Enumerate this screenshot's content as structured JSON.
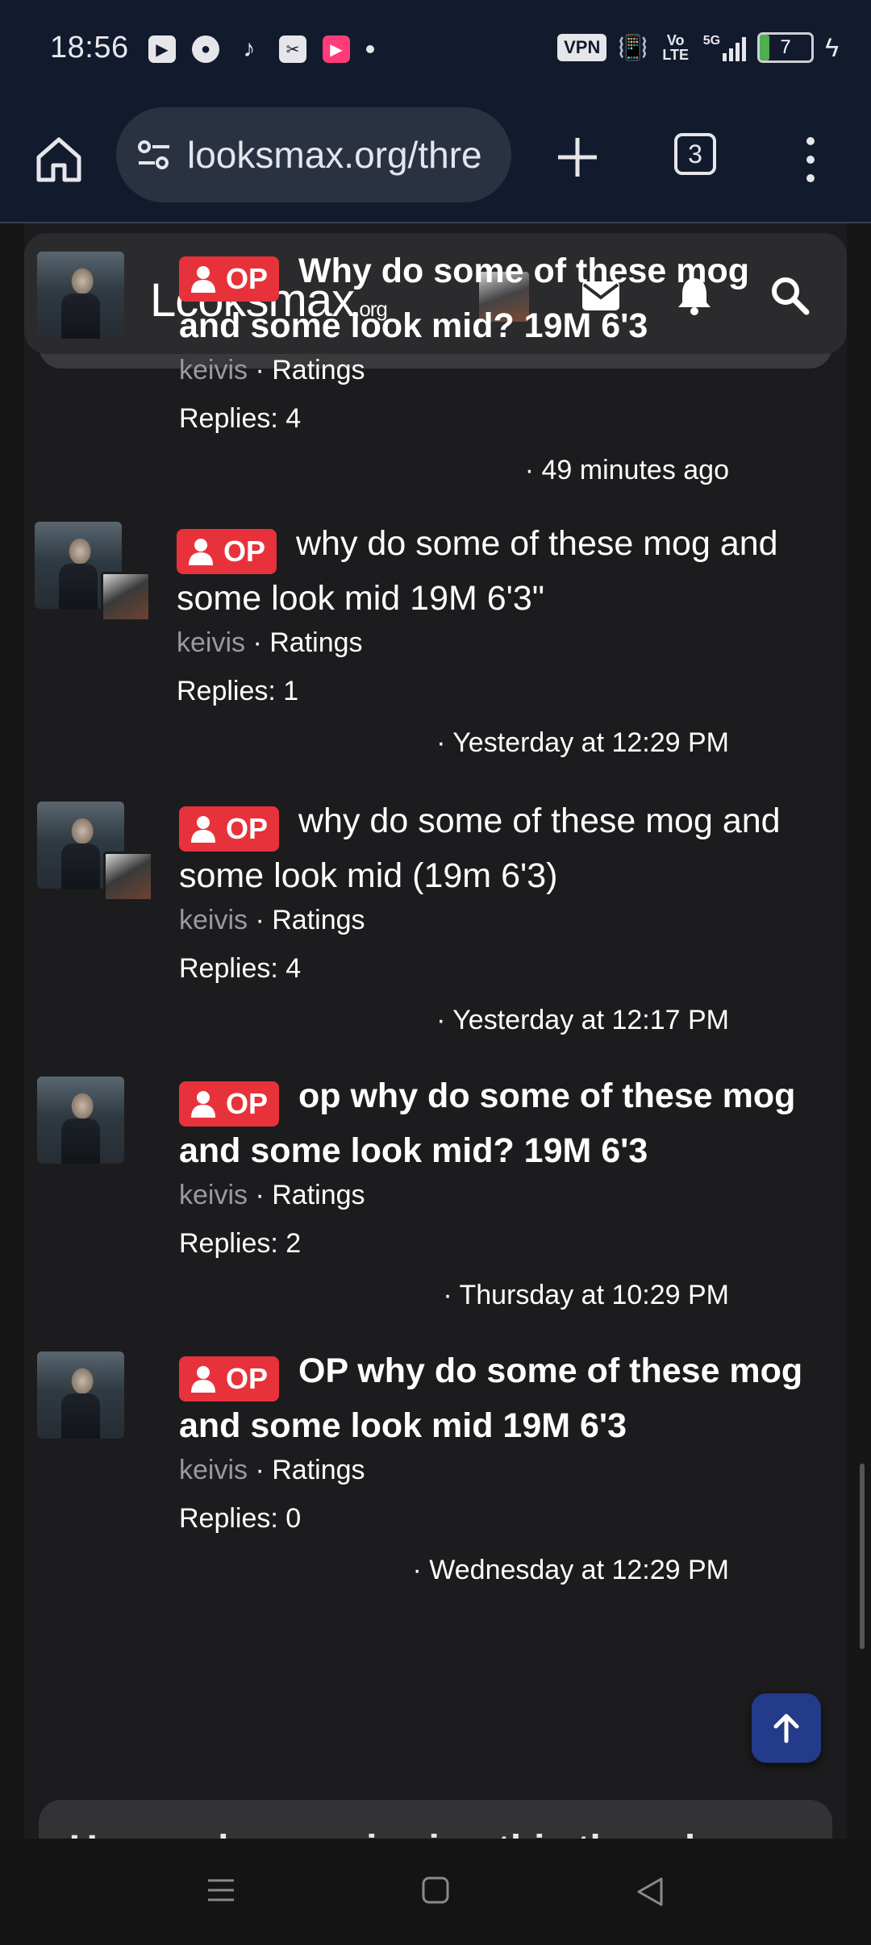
{
  "status_bar": {
    "time": "18:56",
    "vpn_label": "VPN",
    "volte_label": "Vo LTE",
    "network_label": "5G",
    "battery_level": "7"
  },
  "browser": {
    "url": "looksmax.org/thre",
    "tab_count": "3"
  },
  "site": {
    "logo_main": "Lcoksmax",
    "logo_suffix": ".org",
    "bottom_peek_text": "Users who are viewing this thread"
  },
  "threads": [
    {
      "badge": "OP",
      "title": "Why do some of these mog and some look mid? 19M 6'3",
      "title_bold": true,
      "author": "keivis",
      "ratings_label": "· Ratings",
      "replies": "Replies: 4",
      "timestamp": "· 49 minutes ago",
      "has_second_avatar": false
    },
    {
      "badge": "OP",
      "title": "why do some of these mog and some look mid 19M 6'3\"",
      "title_bold": false,
      "author": "keivis",
      "ratings_label": "· Ratings",
      "replies": "Replies: 1",
      "timestamp": "· Yesterday at 12:29 PM",
      "has_second_avatar": true
    },
    {
      "badge": "OP",
      "title": "why do some of these mog and some look mid (19m 6'3)",
      "title_bold": false,
      "author": "keivis",
      "ratings_label": "· Ratings",
      "replies": "Replies: 4",
      "timestamp": "· Yesterday at 12:17 PM",
      "has_second_avatar": true
    },
    {
      "badge": "OP",
      "title": "op why do some of these mog and some look mid? 19M 6'3",
      "title_bold": true,
      "author": "keivis",
      "ratings_label": "· Ratings",
      "replies": "Replies: 2",
      "timestamp": "· Thursday at 10:29 PM",
      "has_second_avatar": false
    },
    {
      "badge": "OP",
      "title": "OP why do some of these mog and some look mid 19M 6'3",
      "title_bold": true,
      "author": "keivis",
      "ratings_label": "· Ratings",
      "replies": "Replies: 0",
      "timestamp": "· Wednesday at 12:29 PM",
      "has_second_avatar": false
    }
  ],
  "colors": {
    "op_badge": "#e8323b",
    "background": "#1c1c1e",
    "browser_bar": "#121a2e",
    "fab": "#243a8a"
  }
}
